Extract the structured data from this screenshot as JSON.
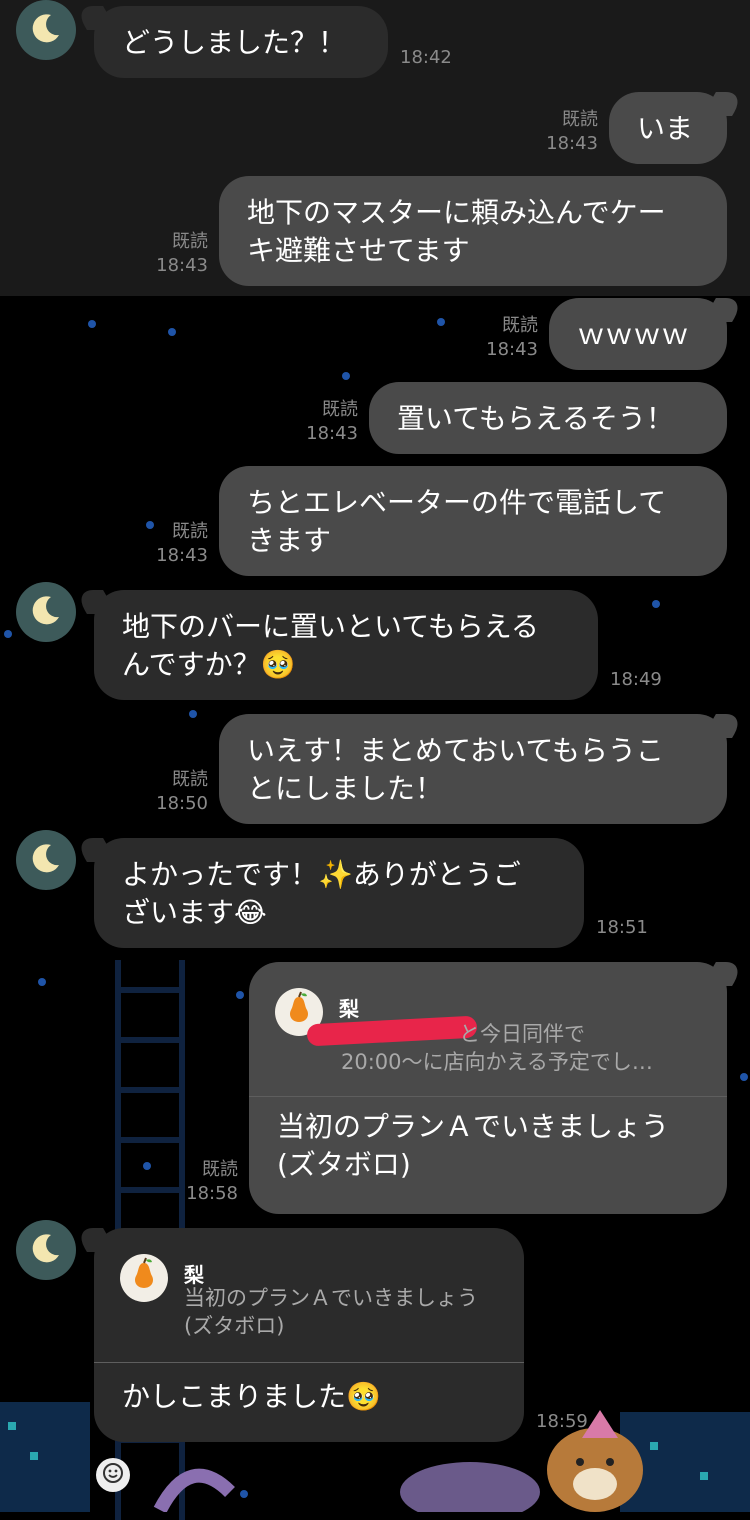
{
  "messages": [
    {
      "text": "どうしました？！",
      "time": "18:42"
    },
    {
      "text": "いま",
      "read": "既読",
      "time": "18:43"
    },
    {
      "text": "地下のマスターに頼み込んでケー\nキ避難させてます",
      "read": "既読",
      "time": "18:43"
    },
    {
      "text": "ｗｗｗｗ",
      "read": "既読",
      "time": "18:43"
    },
    {
      "text": "置いてもらえるそう！",
      "read": "既読",
      "time": "18:43"
    },
    {
      "text": "ちとエレベーターの件で電話して\nきます",
      "read": "既読",
      "time": "18:43"
    },
    {
      "text": "地下のバーに置いといてもらえる\nんですか？🥹",
      "time": "18:49"
    },
    {
      "text": "いえす！まとめておいてもらうこ\nとにしました！",
      "read": "既読",
      "time": "18:50"
    },
    {
      "text": "よかったです！✨ありがとうご\nざいます😂",
      "time": "18:51"
    },
    {
      "reply_name": "梨",
      "reply_quote": "と今日同伴で\n20:00〜に店向かえる予定でし…",
      "text": "当初のプランＡでいきましょう\n(ズタボロ)",
      "read": "既読",
      "time": "18:58"
    },
    {
      "reply_name": "梨",
      "reply_quote": "当初のプランＡでいきましょう\n(ズタボロ)",
      "text": "かしこまりました🥹",
      "time": "18:59"
    }
  ],
  "icons": {
    "avatar": "crescent-moon-icon",
    "reply_avatar": "pear-icon",
    "emoji_button": "smiley-icon"
  },
  "colors": {
    "bubble_in": "#2b2b2b",
    "bubble_out": "#4a4a4a",
    "background": "#000000",
    "redaction": "#e8254a"
  }
}
